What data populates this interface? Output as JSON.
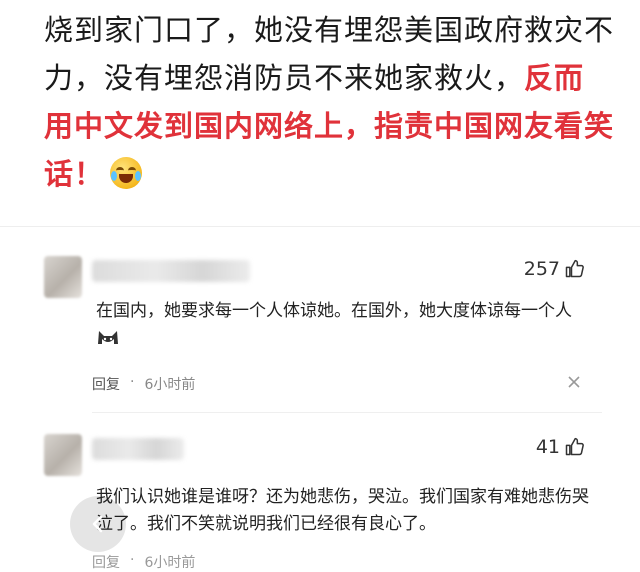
{
  "article": {
    "text_black": "烧到家门口了，她没有埋怨美国政府救灾不力，没有埋怨消防员不来她家救火，",
    "text_red": "反而用中文发到国内网络上，指责中国网友看笑话！",
    "emoji": "laughing-crying-emoji"
  },
  "comments": [
    {
      "likes": "257",
      "text": "在国内，她要求每一个人体谅她。在国外，她大度体谅每一个人",
      "emoji": "cat-emoji",
      "reply_label": "回复",
      "time": "6小时前"
    },
    {
      "likes": "41",
      "text": "我们认识她谁是谁呀？还为她悲伤，哭泣。我们国家有难她悲伤哭泣了。我们不笑就说明我们已经很有良心了。",
      "reply_label": "回复",
      "time": "6小时前"
    }
  ],
  "colors": {
    "accent_red": "#e0323a",
    "meta_gray": "#888888"
  }
}
